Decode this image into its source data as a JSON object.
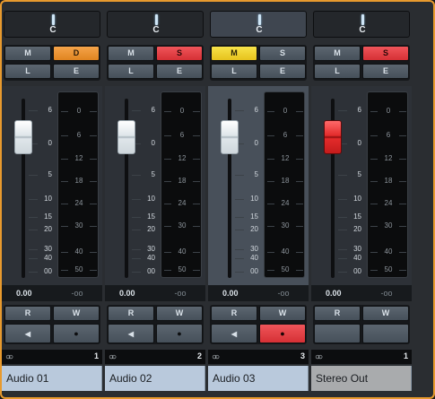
{
  "strips": [
    {
      "name": "Audio 01",
      "number": "1",
      "pan": "C",
      "b1": "M",
      "b2": "D",
      "b3": "L",
      "b4": "E",
      "b2state": "orange",
      "value": "0.00",
      "peak": "-oo",
      "read": "R",
      "write": "W",
      "fader": "white",
      "faderPos": 0.31,
      "wState": "normal",
      "showSpeaker": true,
      "selected": false,
      "nameColor": "blue"
    },
    {
      "name": "Audio 02",
      "number": "2",
      "pan": "C",
      "b1": "M",
      "b2": "S",
      "b3": "L",
      "b4": "E",
      "b2state": "red",
      "value": "0.00",
      "peak": "-oo",
      "read": "R",
      "write": "W",
      "fader": "white",
      "faderPos": 0.31,
      "wState": "normal",
      "showSpeaker": true,
      "selected": false,
      "nameColor": "blue"
    },
    {
      "name": "Audio 03",
      "number": "3",
      "pan": "C",
      "b1": "M",
      "b2": "S",
      "b3": "L",
      "b4": "E",
      "b2state": "normal",
      "b1state": "yellow",
      "value": "0.00",
      "peak": "-oo",
      "read": "R",
      "write": "W",
      "fader": "white",
      "faderPos": 0.31,
      "wState": "red",
      "showSpeaker": true,
      "selected": true,
      "nameColor": "blue"
    },
    {
      "name": "Stereo Out",
      "number": "1",
      "pan": "C",
      "b1": "M",
      "b2": "S",
      "b3": "L",
      "b4": "E",
      "b2state": "red",
      "value": "0.00",
      "peak": "-oo",
      "read": "R",
      "write": "W",
      "fader": "red",
      "faderPos": 0.31,
      "wState": "normal",
      "showSpeaker": false,
      "selected": false,
      "nameColor": "grey"
    }
  ],
  "fader_scale": [
    "6",
    "0",
    "5",
    "10",
    "15",
    "20",
    "30",
    "40",
    "00"
  ],
  "meter_scale": [
    "0",
    "6",
    "12",
    "18",
    "24",
    "30",
    "40",
    "50"
  ],
  "icons": {
    "link": "link-icon",
    "speaker": "speaker-icon",
    "record": "record-dot-icon"
  },
  "colors": {
    "frame": "#e89a2e",
    "solo": "#e8383d",
    "mute": "#f0d22e",
    "disable": "#f29a3a"
  }
}
